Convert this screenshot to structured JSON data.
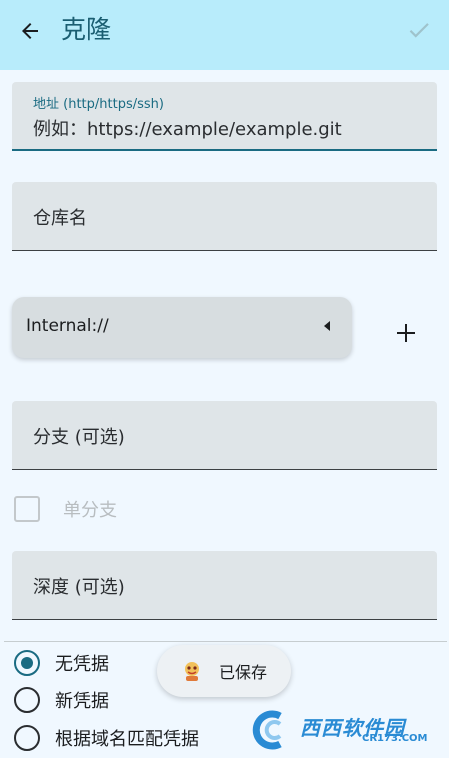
{
  "appbar": {
    "title": "克隆",
    "back_icon": "arrow-back-icon",
    "confirm_icon": "check-icon"
  },
  "form": {
    "url_field": {
      "label": "地址 (http/https/ssh)",
      "value": "例如：https://example/example.git"
    },
    "repo_name_field": {
      "placeholder": "仓库名"
    },
    "storage_dropdown": {
      "selected": "Internal://",
      "arrow_icon": "caret-left-icon"
    },
    "add_icon": "plus-icon",
    "branch_field": {
      "placeholder": "分支 (可选)"
    },
    "single_branch": {
      "label": "单分支",
      "checked": false
    },
    "depth_field": {
      "placeholder": "深度 (可选)"
    }
  },
  "credentials": {
    "options": [
      {
        "label": "无凭据",
        "checked": true
      },
      {
        "label": "新凭据",
        "checked": false
      },
      {
        "label": "根据域名匹配凭据",
        "checked": false
      }
    ]
  },
  "toast": {
    "text": "已保存",
    "icon": "app-logo-icon"
  },
  "watermark": {
    "text": "西西软件园",
    "sub": "CR173.COM"
  },
  "colors": {
    "appbar_bg": "#b8ecfb",
    "accent": "#1a6b82",
    "page_bg": "#f0f8ff",
    "field_bg": "#dfe5e8"
  }
}
